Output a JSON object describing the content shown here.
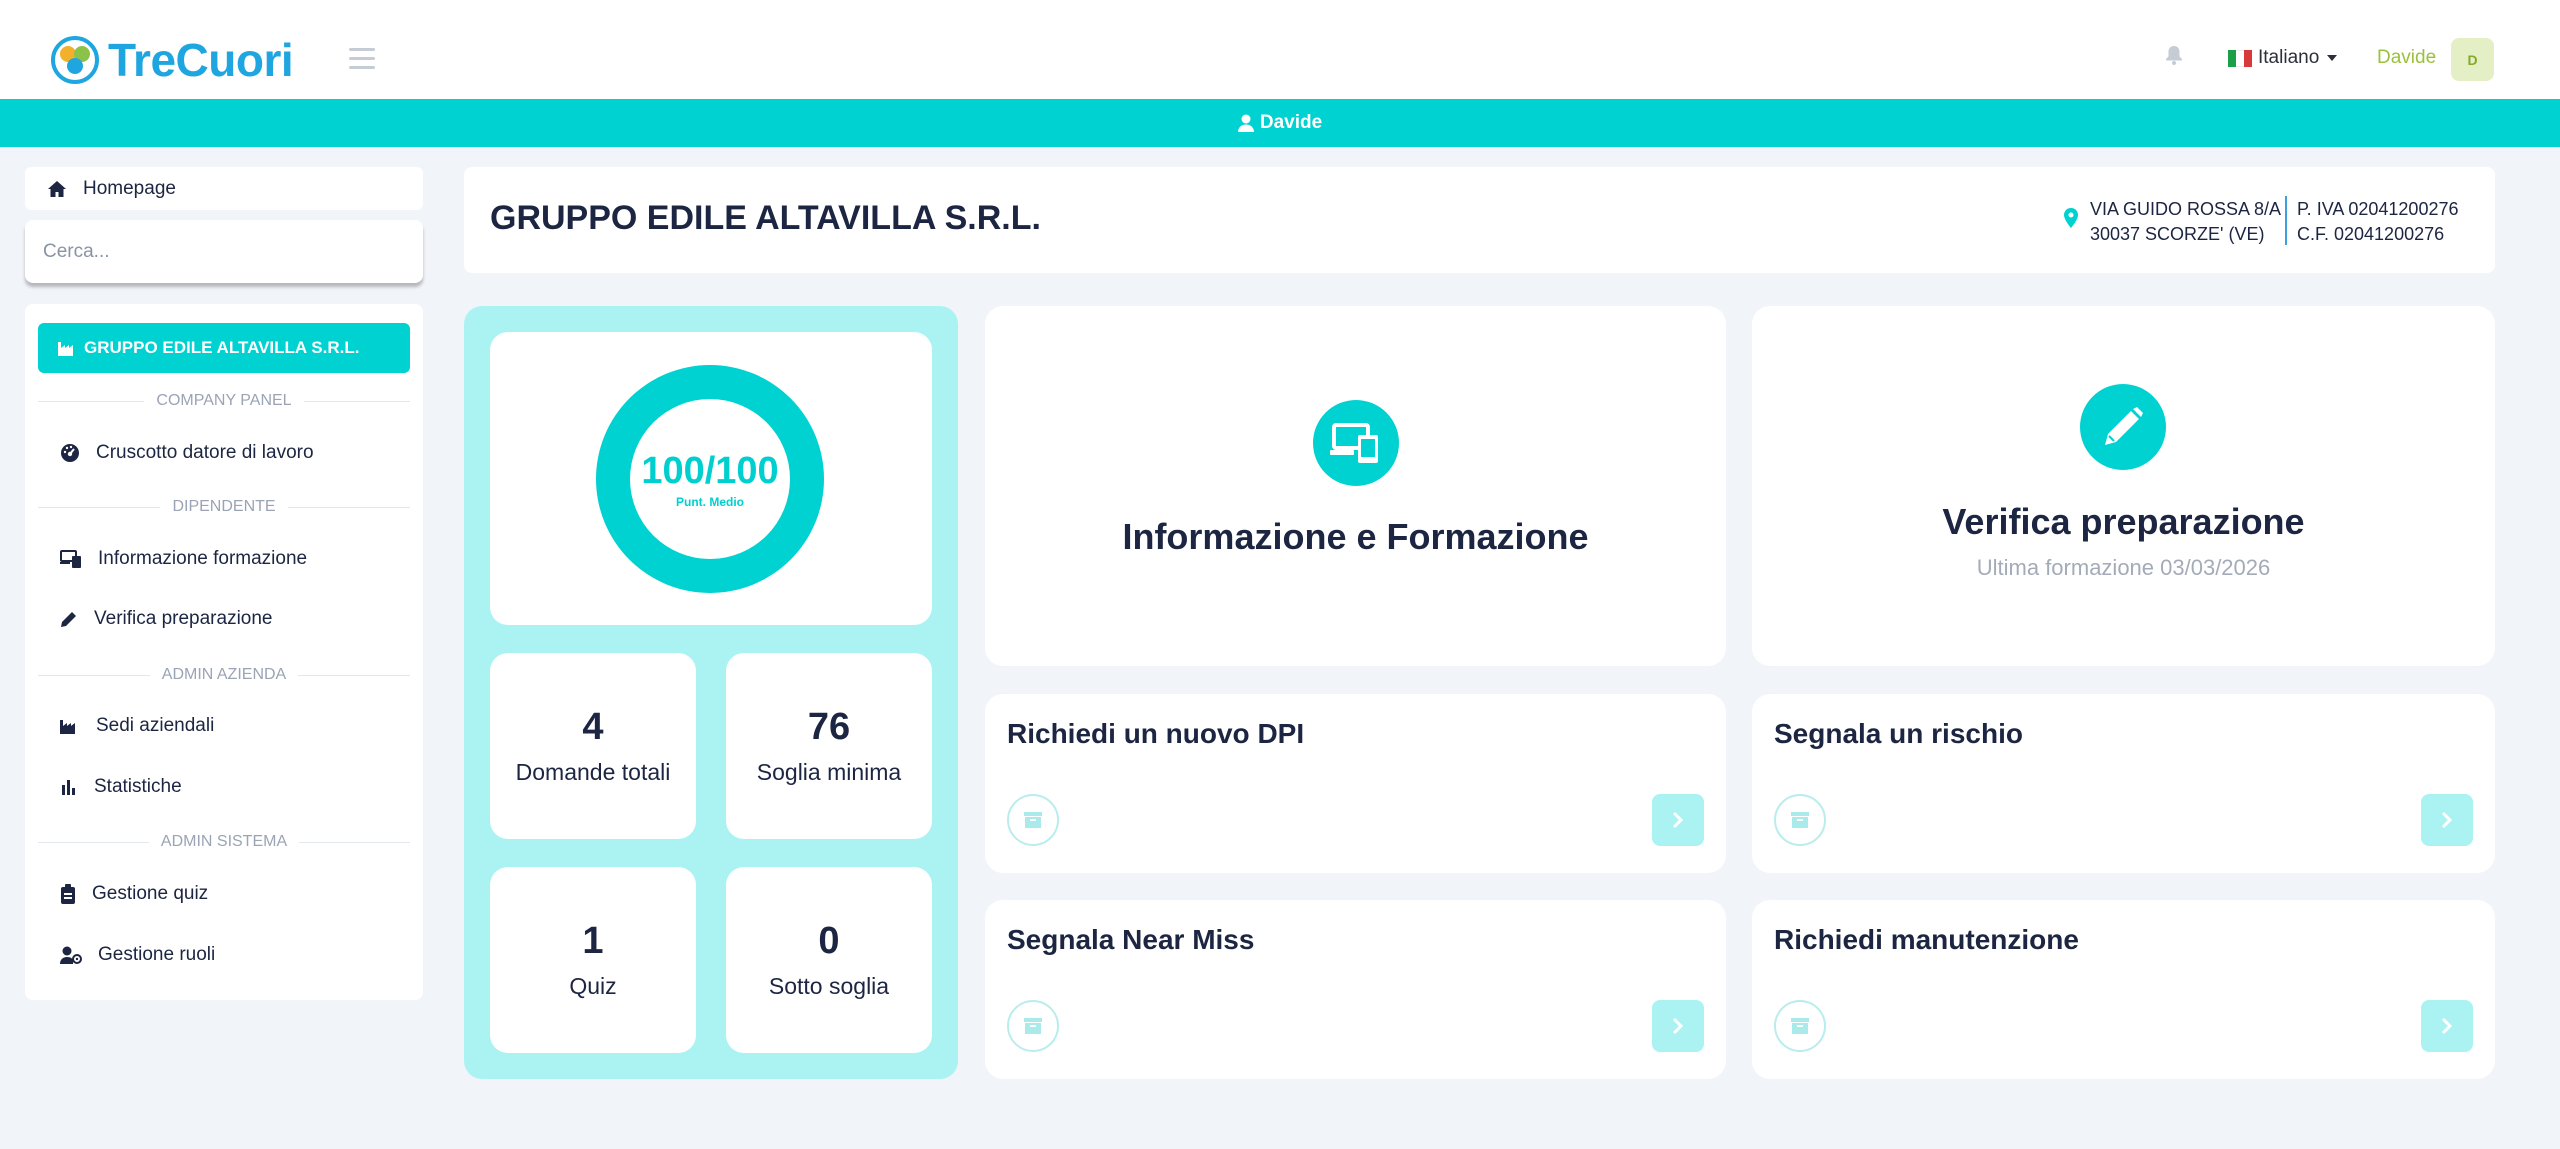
{
  "header": {
    "logo_text": "TreCuori",
    "language": "Italiano",
    "user_name": "Davide",
    "avatar_initial": "D"
  },
  "user_bar": {
    "name": "Davide"
  },
  "sidebar": {
    "home_label": "Homepage",
    "search_placeholder": "Cerca...",
    "company_button": "GRUPPO EDILE ALTAVILLA S.R.L.",
    "sections": {
      "company_panel": "COMPANY PANEL",
      "dipendente": "DIPENDENTE",
      "admin_azienda": "ADMIN AZIENDA",
      "admin_sistema": "ADMIN SISTEMA"
    },
    "items": [
      {
        "label": "Cruscotto datore di lavoro",
        "icon": "gauge-icon"
      },
      {
        "label": "Informazione formazione",
        "icon": "devices-icon"
      },
      {
        "label": "Verifica preparazione",
        "icon": "pencil-icon"
      },
      {
        "label": "Sedi aziendali",
        "icon": "industry-icon"
      },
      {
        "label": "Statistiche",
        "icon": "bar-chart-icon"
      },
      {
        "label": "Gestione quiz",
        "icon": "clipboard-icon"
      },
      {
        "label": "Gestione ruoli",
        "icon": "user-gear-icon"
      }
    ]
  },
  "company": {
    "name": "GRUPPO EDILE ALTAVILLA S.R.L.",
    "address_line1": "VIA GUIDO ROSSA 8/A",
    "address_line2": "30037 SCORZE' (VE)",
    "piva": "P. IVA 02041200276",
    "cf": "C.F. 02041200276"
  },
  "score": {
    "value": "100/100",
    "label": "Punt. Medio",
    "fraction": 1.0
  },
  "stats": [
    {
      "value": "4",
      "label": "Domande totali"
    },
    {
      "value": "76",
      "label": "Soglia minima"
    },
    {
      "value": "1",
      "label": "Quiz"
    },
    {
      "value": "0",
      "label": "Sotto soglia"
    }
  ],
  "cards": {
    "info": {
      "title": "Informazione e Formazione"
    },
    "verifica": {
      "title": "Verifica preparazione",
      "subtitle": "Ultima formazione 03/03/2026"
    },
    "dpi": {
      "title": "Richiedi un nuovo DPI"
    },
    "rischio": {
      "title": "Segnala un rischio"
    },
    "nearmiss": {
      "title": "Segnala Near Miss"
    },
    "manutenzione": {
      "title": "Richiedi manutenzione"
    }
  },
  "colors": {
    "accent": "#00d1d1",
    "accent_light": "#abf3f3",
    "logo": "#1fa6e0",
    "user": "#9bc13b",
    "text": "#1c2541"
  }
}
